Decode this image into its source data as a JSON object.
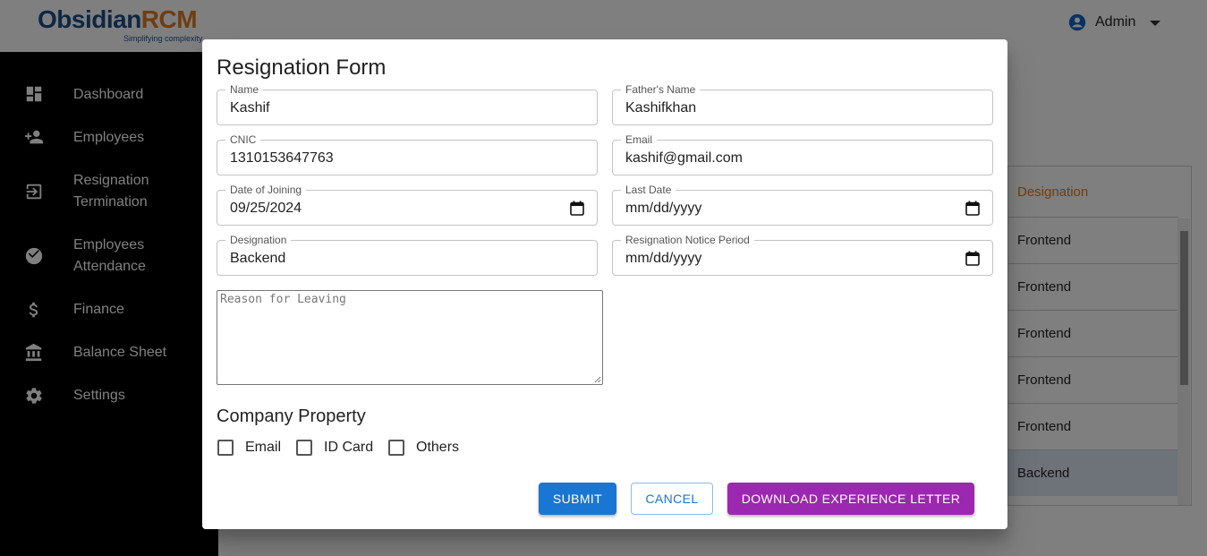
{
  "app": {
    "logo_main_a": "Obsidian",
    "logo_main_b": "RCM",
    "logo_tagline": "Simplifying complexity",
    "user_label": "Admin"
  },
  "sidebar": {
    "items": [
      {
        "label": "Dashboard",
        "icon": "dashboard-icon"
      },
      {
        "label": "Employees",
        "icon": "person-add-icon"
      },
      {
        "label": "Resignation Termination",
        "icon": "exit-icon"
      },
      {
        "label": "Employees Attendance",
        "icon": "check-circle-icon"
      },
      {
        "label": "Finance",
        "icon": "dollar-icon"
      },
      {
        "label": "Balance Sheet",
        "icon": "bank-icon"
      },
      {
        "label": "Settings",
        "icon": "gear-icon"
      }
    ]
  },
  "table": {
    "header": "Designation",
    "rows": [
      "Frontend",
      "Frontend",
      "Frontend",
      "Frontend",
      "Frontend",
      "Backend"
    ]
  },
  "dialog": {
    "title": "Resignation Form",
    "fields": {
      "name": {
        "label": "Name",
        "value": "Kashif"
      },
      "father_name": {
        "label": "Father's Name",
        "value": "Kashifkhan"
      },
      "cnic": {
        "label": "CNIC",
        "value": "1310153647763"
      },
      "email": {
        "label": "Email",
        "value": "kashif@gmail.com"
      },
      "date_of_joining": {
        "label": "Date of Joining",
        "value": "09/25/2024"
      },
      "last_date": {
        "label": "Last Date",
        "value": "mm/dd/yyyy"
      },
      "designation": {
        "label": "Designation",
        "value": "Backend"
      },
      "notice_period": {
        "label": "Resignation Notice Period",
        "value": "mm/dd/yyyy"
      }
    },
    "reason_placeholder": "Reason for Leaving",
    "company_property": {
      "title": "Company Property",
      "options": [
        "Email",
        "ID Card",
        "Others"
      ]
    },
    "buttons": {
      "submit": "Submit",
      "cancel": "Cancel",
      "download": "Download Experience Letter"
    }
  },
  "colors": {
    "primary": "#1976d2",
    "secondary": "#9c27b0",
    "brand_blue": "#1b4f8a",
    "brand_orange": "#e07b20"
  }
}
